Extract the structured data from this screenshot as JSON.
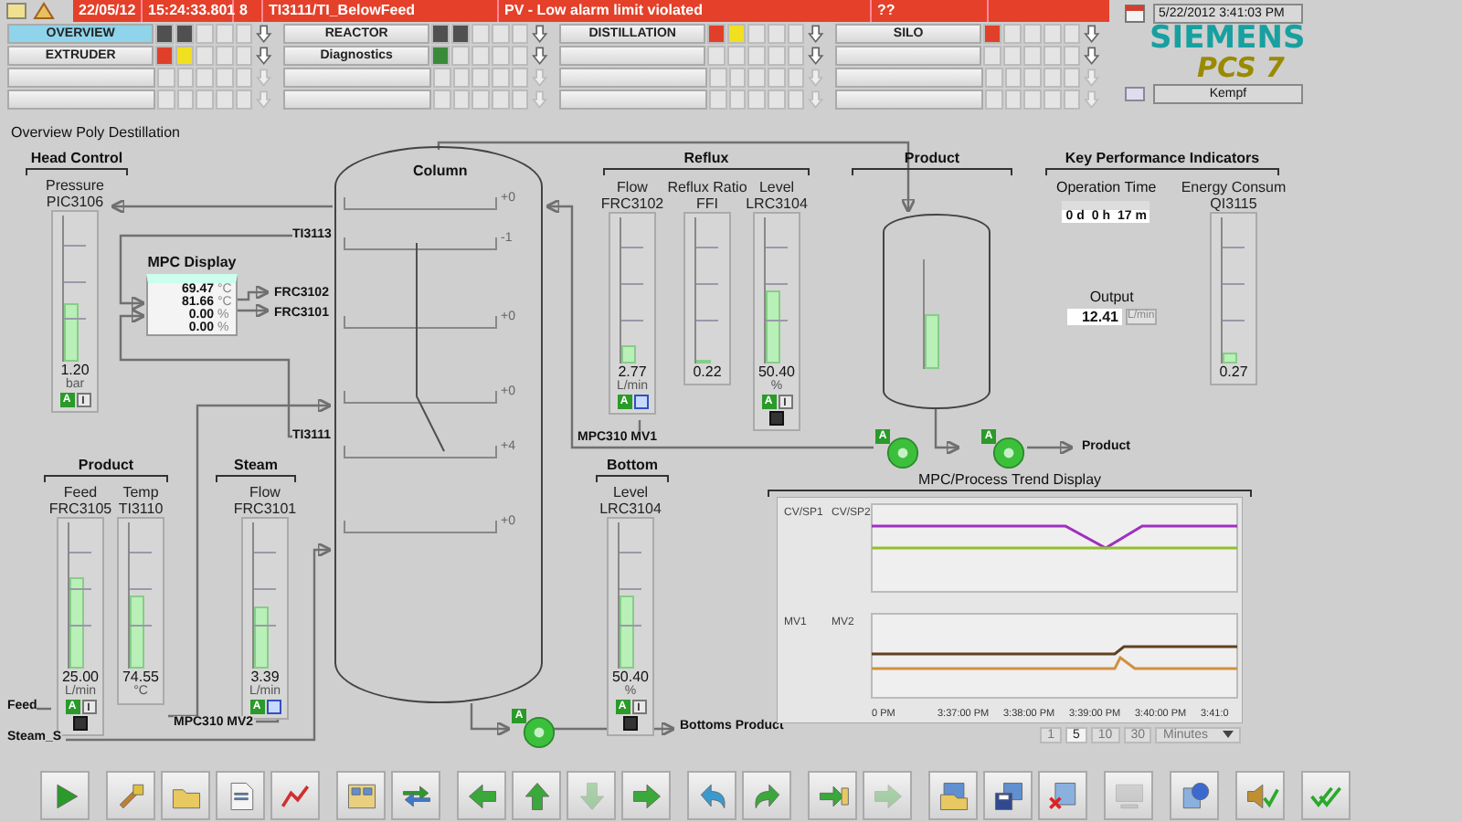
{
  "alarm_bar": {
    "fields": [
      "22/05/12",
      "15:24:33.801",
      "8",
      "TI3111/TI_BelowFeed",
      "PV - Low alarm limit violated",
      "??"
    ]
  },
  "nav": {
    "rows": [
      [
        {
          "label": "OVERVIEW",
          "selected": true,
          "indicators": [
            {
              "color": "#505050"
            },
            {
              "color": "#505050"
            }
          ]
        },
        {
          "label": "REACTOR",
          "selected": false,
          "indicators": [
            {
              "color": "#505050"
            },
            {
              "color": "#505050"
            }
          ]
        },
        {
          "label": "DISTILLATION",
          "selected": false,
          "indicators": [
            {
              "color": "#e0402a"
            },
            {
              "color": "#f0e020"
            }
          ]
        },
        {
          "label": "SILO",
          "selected": false,
          "indicators": [
            {
              "color": "#e0402a"
            }
          ]
        }
      ],
      [
        {
          "label": "EXTRUDER",
          "selected": false,
          "indicators": [
            {
              "color": "#e0402a"
            },
            {
              "color": "#f0e020"
            }
          ]
        },
        {
          "label": "Diagnostics",
          "selected": false,
          "indicators": [
            {
              "color": "#3a8a3a"
            }
          ]
        },
        {
          "selected": false
        },
        {
          "selected": false
        }
      ]
    ]
  },
  "datetime": "5/22/2012 3:41:03 PM",
  "logo": {
    "brand": "SIEMENS",
    "product": "PCS 7"
  },
  "user": "Kempf",
  "page_title": "Overview Poly Destillation",
  "groups": [
    {
      "label": "Head Control"
    },
    {
      "label": "Reflux"
    },
    {
      "label": "Product"
    },
    {
      "label": "Key Performance Indicators"
    },
    {
      "label": "Product"
    },
    {
      "label": "Steam"
    },
    {
      "label": "Bottom"
    }
  ],
  "bars": [
    {
      "name": "Pressure",
      "tag": "PIC3106",
      "value": "1.20",
      "unit": "bar",
      "level": 0.4,
      "badges": [
        {
          "kind": "auto",
          "text": "A"
        },
        {
          "kind": "internal",
          "text": "I"
        }
      ]
    },
    {
      "name": "Flow",
      "tag": "FRC3102",
      "value": "2.77",
      "unit": "L/min",
      "level": 0.12,
      "badges": [
        {
          "kind": "auto",
          "text": "A"
        },
        {
          "kind": "external"
        }
      ]
    },
    {
      "name": "Reflux Ratio",
      "tag": "FFI",
      "value": "0.22",
      "level": 0
    },
    {
      "name": "Level",
      "tag": "LRC3104",
      "value": "50.40",
      "unit": "%",
      "level": 0.5,
      "badges": [
        {
          "kind": "auto",
          "text": "A"
        },
        {
          "kind": "internal",
          "text": "I"
        },
        {
          "kind": "lock"
        }
      ]
    },
    {
      "name": "Energy Consum",
      "tag": "QI3115",
      "value": "0.27",
      "level": 0.08
    },
    {
      "name": "Feed",
      "tag": "FRC3105",
      "value": "25.00",
      "unit": "L/min",
      "level": 0.62,
      "badges": [
        {
          "kind": "auto",
          "text": "A"
        },
        {
          "kind": "internal",
          "text": "I"
        },
        {
          "kind": "lock"
        }
      ]
    },
    {
      "name": "Temp",
      "tag": "TI3110",
      "value": "74.55",
      "unit": "°C",
      "level": 0.5
    },
    {
      "name": "Flow",
      "tag": "FRC3101",
      "value": "3.39",
      "unit": "L/min",
      "level": 0.42,
      "badges": [
        {
          "kind": "auto",
          "text": "A"
        },
        {
          "kind": "external"
        }
      ]
    },
    {
      "name": "Level",
      "tag": "LRC3104",
      "value": "50.40",
      "unit": "%",
      "level": 0.5,
      "badges": [
        {
          "kind": "auto",
          "text": "A"
        },
        {
          "kind": "internal",
          "text": "I"
        },
        {
          "kind": "lock"
        }
      ]
    }
  ],
  "column": {
    "title": "Column",
    "trays": [
      "+0",
      "-1",
      "+0",
      "+0",
      "+4",
      "+0"
    ]
  },
  "tank": {
    "level": 0.5
  },
  "mpc": {
    "title": "MPC Display",
    "rows": [
      {
        "value": "69.47",
        "unit": "°C"
      },
      {
        "value": "81.66",
        "unit": "°C"
      },
      {
        "value": "0.00",
        "unit": "%"
      },
      {
        "value": "0.00",
        "unit": "%"
      }
    ]
  },
  "labels": [
    "TI3113",
    "FRC3102",
    "FRC3101",
    "TI3111",
    "MPC310 MV1",
    "Product",
    "MPC310 MV2",
    "Bottoms Product",
    "Feed",
    "Steam_S"
  ],
  "pumps": [
    {
      "badge": "A"
    },
    {
      "badge": "A"
    },
    {
      "badge": "A"
    }
  ],
  "kpi": {
    "op_time_label": "Operation Time",
    "op_time": [
      "0 d",
      "0 h",
      "17 m"
    ],
    "output_label": "Output",
    "output_value": "12.41",
    "output_unit": "L/min"
  },
  "trend": {
    "title": "MPC/Process Trend Display",
    "axes": [
      "CV/SP1",
      "CV/SP2",
      "MV1",
      "MV2"
    ],
    "x_labels": [
      "0 PM",
      "3:37:00 PM",
      "3:38:00 PM",
      "3:39:00 PM",
      "3:40:00 PM",
      "3:41:0"
    ],
    "ranges": [
      {
        "label": "1",
        "selected": false
      },
      {
        "label": "5",
        "selected": true
      },
      {
        "label": "10",
        "selected": false
      },
      {
        "label": "30",
        "selected": false
      }
    ],
    "unit": "Minutes"
  },
  "toolbar": {
    "groups": [
      [
        {
          "kind": "play",
          "disabled": false
        }
      ],
      [
        {
          "kind": "tool",
          "disabled": false
        },
        {
          "kind": "folder",
          "disabled": false
        },
        {
          "kind": "doc",
          "disabled": false
        },
        {
          "kind": "chart",
          "disabled": false
        }
      ],
      [
        {
          "kind": "grid",
          "disabled": false
        },
        {
          "kind": "swap",
          "disabled": false
        }
      ],
      [
        {
          "kind": "left",
          "disabled": false
        },
        {
          "kind": "up",
          "disabled": false
        },
        {
          "kind": "down",
          "disabled": true
        },
        {
          "kind": "right",
          "disabled": false
        }
      ],
      [
        {
          "kind": "undo",
          "disabled": false
        },
        {
          "kind": "redo",
          "disabled": false
        }
      ],
      [
        {
          "kind": "enter",
          "disabled": false
        },
        {
          "kind": "right",
          "disabled": true
        }
      ],
      [
        {
          "kind": "open",
          "disabled": false
        },
        {
          "kind": "save",
          "disabled": false
        },
        {
          "kind": "delete",
          "disabled": false
        }
      ],
      [
        {
          "kind": "screen",
          "disabled": true
        }
      ],
      [
        {
          "kind": "info",
          "disabled": false
        }
      ],
      [
        {
          "kind": "sound",
          "disabled": false
        }
      ],
      [
        {
          "kind": "ack",
          "disabled": false
        }
      ]
    ]
  }
}
